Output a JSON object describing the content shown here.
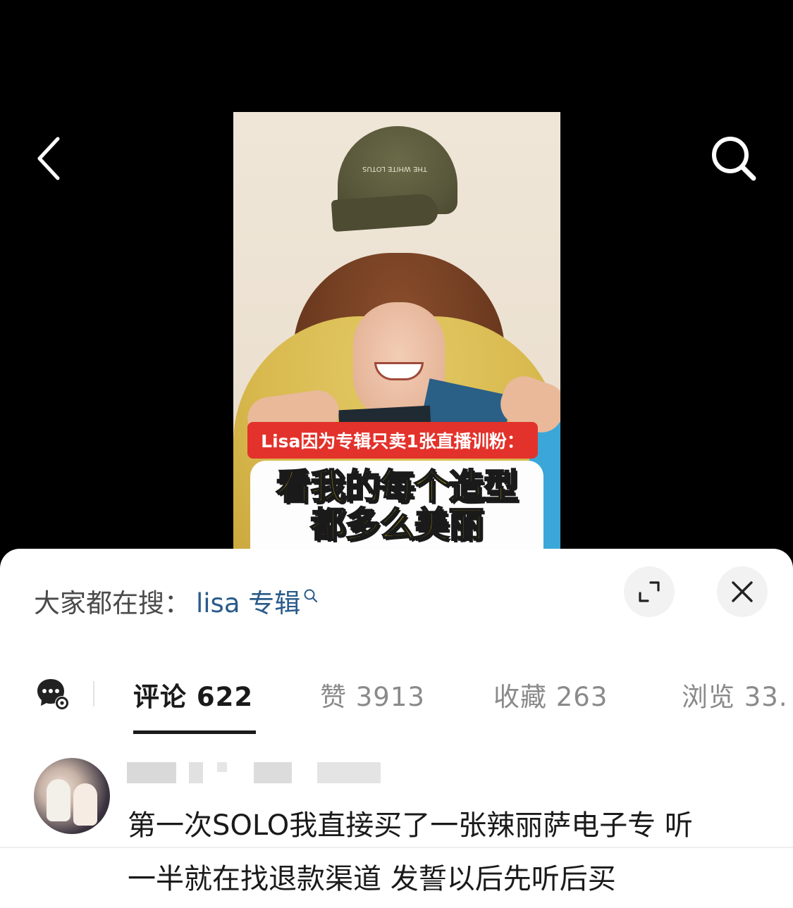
{
  "nav": {
    "back_icon": "chevron-left-icon",
    "search_icon": "search-icon"
  },
  "video": {
    "cap_text": "THE WHITE LOTUS",
    "banner_text": "Lisa因为专辑只卖1张直播训粉：",
    "caption_line1": "看我的每个造型",
    "caption_line2": "都多么美丽"
  },
  "sheet": {
    "search_hint_label": "大家都在搜：",
    "search_hint_keyword": "lisa 专辑",
    "expand_icon": "expand-icon",
    "close_icon": "close-icon"
  },
  "tabs": [
    {
      "label": "评论 622",
      "active": true
    },
    {
      "label": "赞 3913",
      "active": false
    },
    {
      "label": "收藏 263",
      "active": false
    },
    {
      "label": "浏览 33.",
      "active": false
    }
  ],
  "comment": {
    "text_line1": "第一次SOLO我直接买了一张辣丽萨电子专 听",
    "text_line2": "一半就在找退款渠道 发誓以后先听后买"
  },
  "colors": {
    "accent_link": "#2a5b8a",
    "banner_red": "#e3322b",
    "caption_yellow": "#ffe100"
  }
}
